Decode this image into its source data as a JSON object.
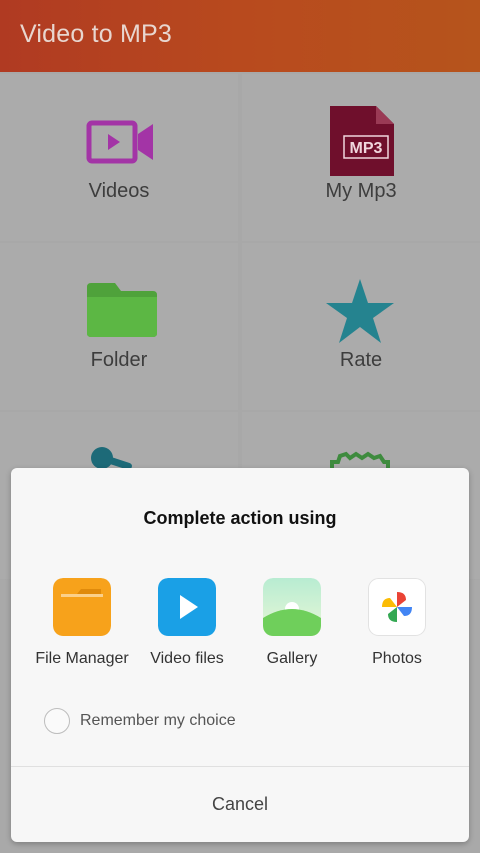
{
  "app": {
    "title": "Video to MP3",
    "accent_color": "#b5441f"
  },
  "menu": {
    "items": [
      {
        "label": "Videos",
        "icon": "video-camera-icon",
        "color": "#a334a6"
      },
      {
        "label": "My Mp3",
        "icon": "mp3-file-icon",
        "color": "#6f0f2c",
        "badge": "MP3"
      },
      {
        "label": "Folder",
        "icon": "folder-icon",
        "color": "#4fa23b"
      },
      {
        "label": "Rate",
        "icon": "star-icon",
        "color": "#25838f"
      },
      {
        "label": "",
        "icon": "microphone-icon",
        "color": "#1d6a78"
      },
      {
        "label": "",
        "icon": "gear-icon",
        "color": "#3e8b3e"
      }
    ]
  },
  "dialog": {
    "title": "Complete action using",
    "options": [
      {
        "label": "File Manager",
        "icon": "file-manager-icon",
        "color": "#f7a21b"
      },
      {
        "label": "Video files",
        "icon": "video-player-icon",
        "color": "#1aa0e6"
      },
      {
        "label": "Gallery",
        "icon": "gallery-icon",
        "color": "#6fcf5b"
      },
      {
        "label": "Photos",
        "icon": "photos-pinwheel-icon",
        "color": "#ffffff"
      }
    ],
    "remember_label": "Remember my choice",
    "remember_checked": false,
    "cancel_label": "Cancel"
  }
}
